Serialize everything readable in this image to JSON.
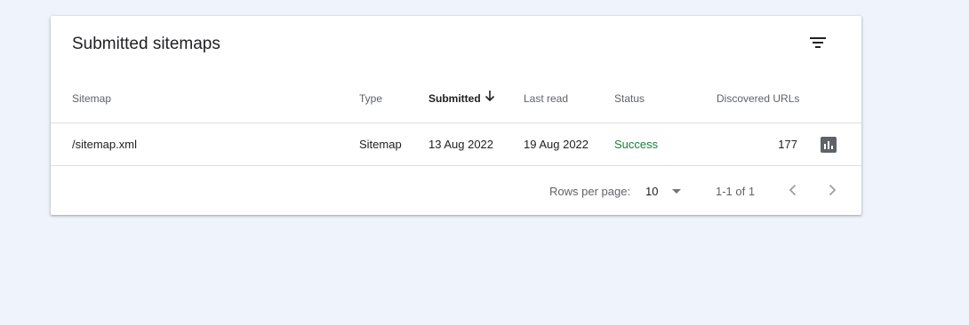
{
  "card": {
    "title": "Submitted sitemaps",
    "filter_icon": "filter-list-icon"
  },
  "table": {
    "columns": [
      {
        "key": "sitemap",
        "label": "Sitemap"
      },
      {
        "key": "type",
        "label": "Type"
      },
      {
        "key": "submitted",
        "label": "Submitted",
        "sorted": "descending",
        "icon": "arrow-down-icon"
      },
      {
        "key": "last_read",
        "label": "Last read"
      },
      {
        "key": "status",
        "label": "Status"
      },
      {
        "key": "discovered_urls",
        "label": "Discovered URLs"
      }
    ],
    "rows": [
      {
        "sitemap": "/sitemap.xml",
        "type": "Sitemap",
        "submitted": "13 Aug 2022",
        "last_read": "19 Aug 2022",
        "status": "Success",
        "discovered_urls": "177",
        "action_icon": "bar-chart-icon"
      }
    ]
  },
  "pagination": {
    "rows_per_page_label": "Rows per page:",
    "rows_per_page_value": "10",
    "range": "1-1 of 1",
    "prev_icon": "chevron-left-icon",
    "next_icon": "chevron-right-icon"
  },
  "colors": {
    "background": "#eff3fb",
    "status_success": "#188038",
    "icon": "#5f6368"
  }
}
